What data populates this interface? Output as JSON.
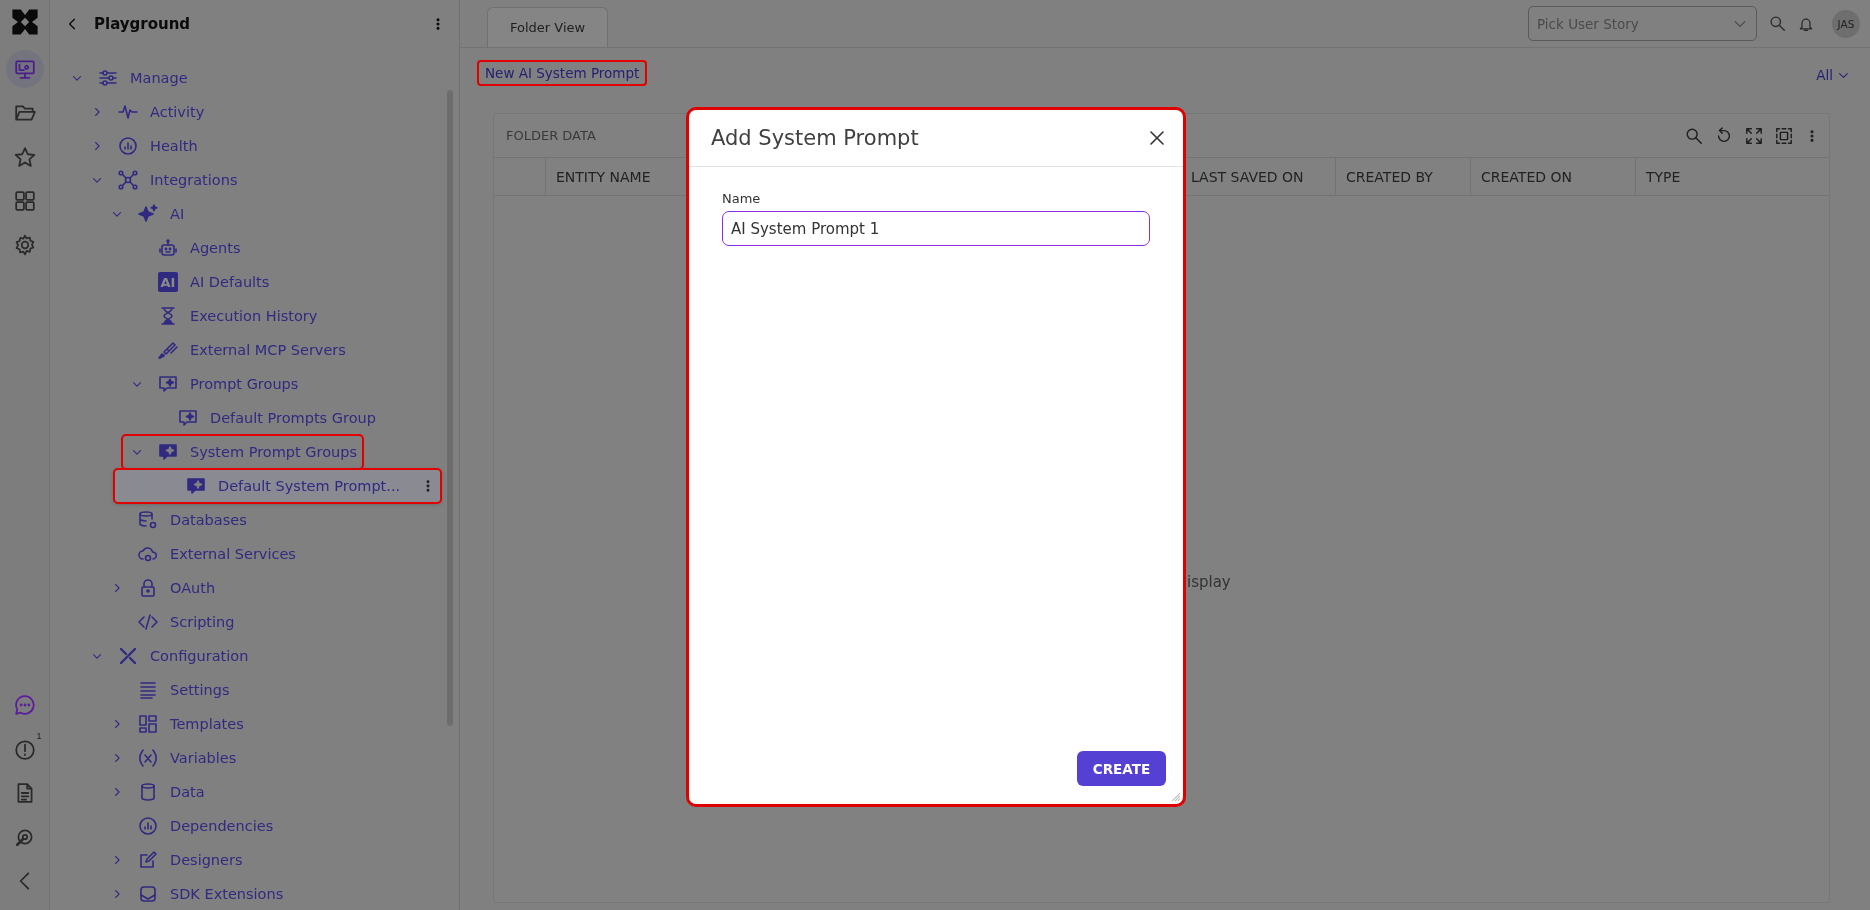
{
  "rail": {
    "top_items": [
      {
        "selected": true
      },
      {
        "selected": false
      },
      {
        "selected": false
      },
      {
        "selected": false
      },
      {
        "selected": false
      }
    ],
    "alerts_badge": "1"
  },
  "sidebar": {
    "title": "Playground",
    "tree": [
      {
        "label": "Manage",
        "expanded": true,
        "selected": false,
        "highlighted": false,
        "children": [
          {
            "label": "Activity",
            "expanded": false,
            "selected": false,
            "highlighted": false
          },
          {
            "label": "Health",
            "expanded": false,
            "selected": false,
            "highlighted": false
          },
          {
            "label": "Integrations",
            "expanded": true,
            "selected": false,
            "highlighted": false,
            "children": [
              {
                "label": "AI",
                "expanded": true,
                "selected": false,
                "highlighted": false,
                "children": [
                  {
                    "label": "Agents",
                    "selected": false,
                    "highlighted": false
                  },
                  {
                    "label": "AI Defaults",
                    "icon_text": "AI",
                    "selected": false,
                    "highlighted": false
                  },
                  {
                    "label": "Execution History",
                    "selected": false,
                    "highlighted": false
                  },
                  {
                    "label": "External MCP Servers",
                    "selected": false,
                    "highlighted": false
                  },
                  {
                    "label": "Prompt Groups",
                    "expanded": true,
                    "selected": false,
                    "highlighted": false,
                    "children": [
                      {
                        "label": "Default Prompts Group",
                        "selected": false,
                        "highlighted": false
                      }
                    ]
                  },
                  {
                    "label": "System Prompt Groups",
                    "expanded": true,
                    "selected": false,
                    "highlighted": true,
                    "children": [
                      {
                        "label": "Default System Prompt...",
                        "selected": true,
                        "highlighted": true
                      }
                    ]
                  }
                ]
              },
              {
                "label": "Databases",
                "selected": false,
                "highlighted": false
              },
              {
                "label": "External Services",
                "selected": false,
                "highlighted": false
              },
              {
                "label": "OAuth",
                "expanded": false,
                "selected": false,
                "highlighted": false
              },
              {
                "label": "Scripting",
                "selected": false,
                "highlighted": false
              }
            ]
          },
          {
            "label": "Configuration",
            "expanded": true,
            "selected": false,
            "highlighted": false,
            "children": [
              {
                "label": "Settings",
                "selected": false,
                "highlighted": false
              },
              {
                "label": "Templates",
                "expanded": false,
                "selected": false,
                "highlighted": false
              },
              {
                "label": "Variables",
                "expanded": false,
                "selected": false,
                "highlighted": false
              },
              {
                "label": "Data",
                "expanded": false,
                "selected": false,
                "highlighted": false
              },
              {
                "label": "Dependencies",
                "selected": false,
                "highlighted": false
              },
              {
                "label": "Designers",
                "expanded": false,
                "selected": false,
                "highlighted": false
              },
              {
                "label": "SDK Extensions",
                "expanded": false,
                "selected": false,
                "highlighted": false
              }
            ]
          }
        ]
      }
    ]
  },
  "topbar": {
    "tabs": [
      {
        "label": "Folder View",
        "selected": true
      }
    ],
    "story_picker": {
      "placeholder": "Pick User Story"
    },
    "avatar": "JAS"
  },
  "toolbar": {
    "new_button": {
      "label": "New AI System Prompt",
      "highlighted": true
    },
    "filter": "All"
  },
  "table": {
    "title": "FOLDER DATA",
    "columns": [
      "ENTITY NAME",
      "LAST SAVED ON",
      "CREATED BY",
      "CREATED ON",
      "TYPE"
    ],
    "empty_text": "isplay"
  },
  "dialog": {
    "title": "Add System Prompt",
    "highlighted": true,
    "field": {
      "label": "Name",
      "value": "AI System Prompt 1"
    },
    "button": "CREATE"
  }
}
